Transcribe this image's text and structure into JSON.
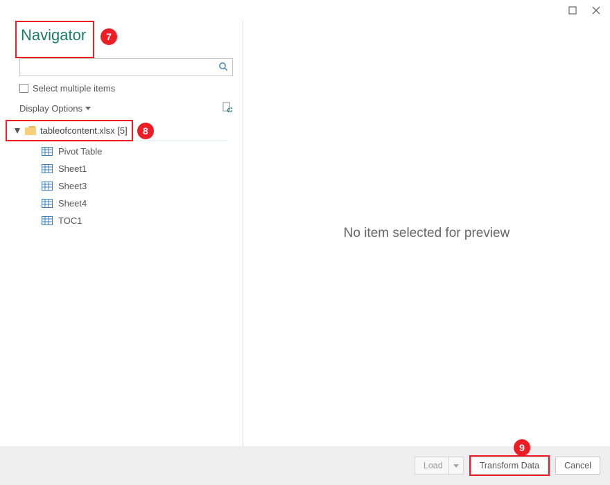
{
  "window": {
    "title": "Navigator"
  },
  "search": {
    "placeholder": ""
  },
  "options": {
    "selectMultipleLabel": "Select multiple items",
    "displayOptionsLabel": "Display Options"
  },
  "tree": {
    "fileName": "tableofcontent.xlsx [5]",
    "sheets": [
      {
        "name": "Pivot Table"
      },
      {
        "name": "Sheet1"
      },
      {
        "name": "Sheet3"
      },
      {
        "name": "Sheet4"
      },
      {
        "name": "TOC1"
      }
    ]
  },
  "preview": {
    "emptyMessage": "No item selected for preview"
  },
  "footer": {
    "loadLabel": "Load",
    "transformLabel": "Transform Data",
    "cancelLabel": "Cancel"
  },
  "callouts": {
    "heading": "7",
    "file": "8",
    "transform": "9"
  },
  "colors": {
    "accent": "#197d63",
    "callout": "#ee1c25"
  }
}
